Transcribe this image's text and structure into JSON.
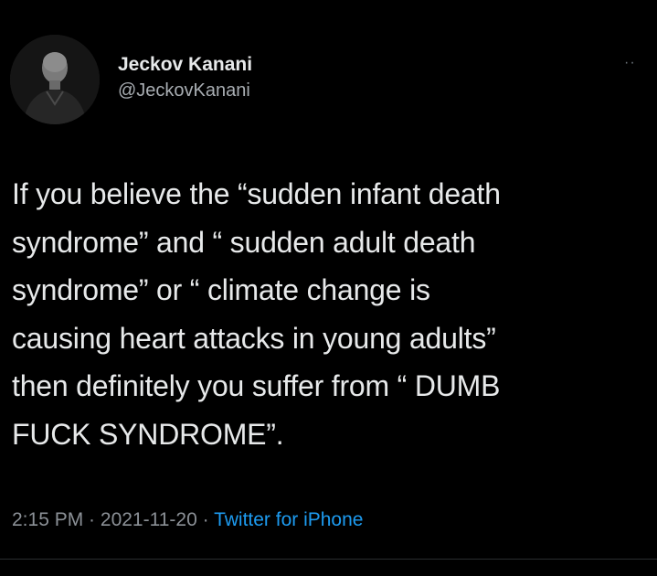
{
  "author": {
    "name": "Jeckov Kanani",
    "handle": "@JeckovKanani"
  },
  "menu": {
    "more_label": "··"
  },
  "tweet": {
    "lines": [
      "If you believe the “sudden infant death",
      "syndrome” and “ sudden adult death",
      "syndrome” or “ climate change is",
      "causing heart attacks in young adults”",
      "then definitely you suffer from “ DUMB",
      "FUCK SYNDROME”."
    ]
  },
  "meta": {
    "time": "2:15 PM",
    "separator": " · ",
    "date": "2021-11-20",
    "source": "Twitter for iPhone"
  },
  "colors": {
    "background": "#000000",
    "text": "#e7e9ea",
    "secondary": "#8b9096",
    "link": "#1d9bf0"
  }
}
